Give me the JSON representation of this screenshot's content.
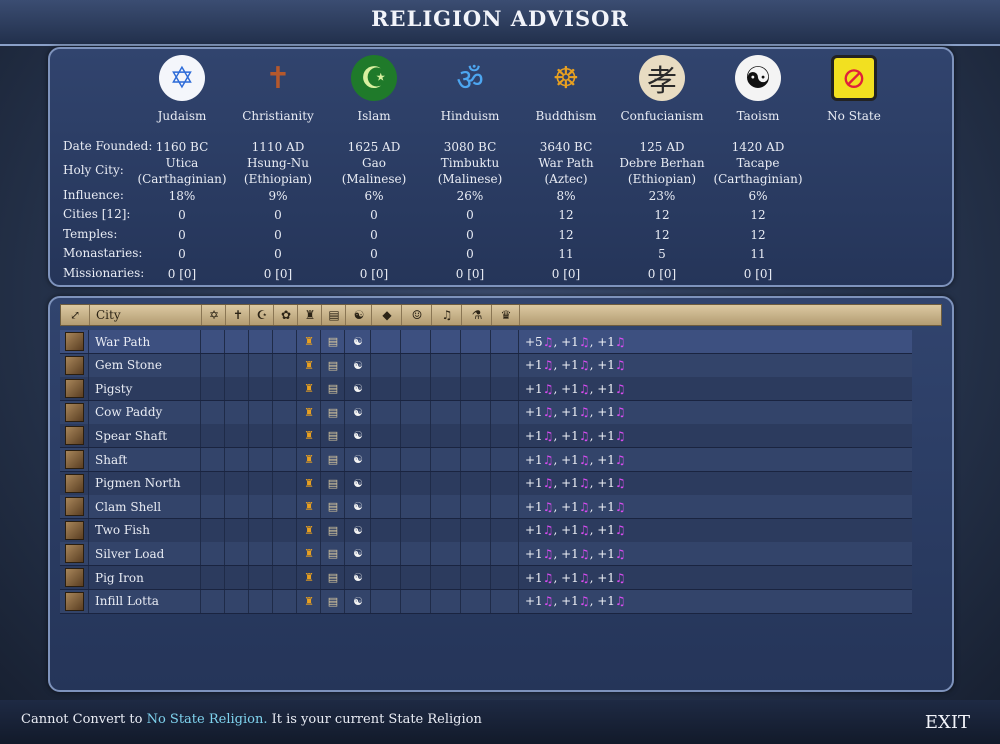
{
  "title": "RELIGION ADVISOR",
  "religions": [
    {
      "name": "Judaism",
      "icon": "star-of-david-icon",
      "glyph": "✡",
      "color": "#2d6bd8",
      "bg": "#f4f6fb",
      "date": "1160 BC",
      "holy1": "Utica",
      "holy2": "(Carthaginian)",
      "influence": "18%",
      "cities": "0",
      "temples": "0",
      "monasteries": "0",
      "missionaries": "0 [0]"
    },
    {
      "name": "Christianity",
      "icon": "cross-icon",
      "glyph": "✝",
      "color": "#b5582c",
      "bg": "transparent",
      "date": "1110 AD",
      "holy1": "Hsung-Nu",
      "holy2": "(Ethiopian)",
      "influence": "9%",
      "cities": "0",
      "temples": "0",
      "monasteries": "0",
      "missionaries": "0 [0]"
    },
    {
      "name": "Islam",
      "icon": "crescent-star-icon",
      "glyph": "☪",
      "color": "#d9f0a0",
      "bg": "#1f7a2a",
      "date": "1625 AD",
      "holy1": "Gao",
      "holy2": "(Malinese)",
      "influence": "6%",
      "cities": "0",
      "temples": "0",
      "monasteries": "0",
      "missionaries": "0 [0]"
    },
    {
      "name": "Hinduism",
      "icon": "om-icon",
      "glyph": "ॐ",
      "color": "#4da6f0",
      "bg": "transparent",
      "date": "3080 BC",
      "holy1": "Timbuktu",
      "holy2": "(Malinese)",
      "influence": "26%",
      "cities": "0",
      "temples": "0",
      "monasteries": "0",
      "missionaries": "0 [0]"
    },
    {
      "name": "Buddhism",
      "icon": "buddha-icon",
      "glyph": "☸",
      "color": "#e8a020",
      "bg": "transparent",
      "date": "3640 BC",
      "holy1": "War Path",
      "holy2": "(Aztec)",
      "influence": "8%",
      "cities": "12",
      "temples": "12",
      "monasteries": "11",
      "missionaries": "0 [0]"
    },
    {
      "name": "Confucianism",
      "icon": "confucian-glyph-icon",
      "glyph": "孝",
      "color": "#2a2a2a",
      "bg": "#e8dcc2",
      "date": "125 AD",
      "holy1": "Debre Berhan",
      "holy2": "(Ethiopian)",
      "influence": "23%",
      "cities": "12",
      "temples": "12",
      "monasteries": "5",
      "missionaries": "0 [0]"
    },
    {
      "name": "Taoism",
      "icon": "yin-yang-icon",
      "glyph": "☯",
      "color": "#111111",
      "bg": "#f4f4f4",
      "date": "1420 AD",
      "holy1": "Tacape",
      "holy2": "(Carthaginian)",
      "influence": "6%",
      "cities": "12",
      "temples": "12",
      "monasteries": "11",
      "missionaries": "0 [0]"
    },
    {
      "name": "No State",
      "icon": "no-state-icon",
      "glyph": "⊘",
      "color": "#e0203a",
      "bg": "#f2e020"
    }
  ],
  "row_labels": {
    "date": "Date Founded:",
    "holy": "Holy City:",
    "influence": "Influence:",
    "cities": "Cities [12]:",
    "temples": "Temples:",
    "monasteries": "Monastaries:",
    "missionaries": "Missionaries:"
  },
  "table": {
    "city_header": "City",
    "columns": [
      "judaism-icon",
      "christianity-icon",
      "islam-icon",
      "hinduism-icon",
      "buddhism-icon",
      "confucianism-icon",
      "taoism-icon",
      "culture-icon",
      "happy-face-icon",
      "music-note-icon",
      "beaker-icon",
      "gold-icon"
    ],
    "column_glyphs": [
      "✡",
      "✝",
      "☪",
      "✿",
      "♜",
      "▤",
      "☯",
      "◆",
      "☺",
      "♫",
      "⚗",
      "♛"
    ],
    "rows": [
      {
        "city": "War Path",
        "effect_first": "+5",
        "effect_rest": "+1"
      },
      {
        "city": "Gem Stone",
        "effect_first": "+1",
        "effect_rest": "+1"
      },
      {
        "city": "Pigsty",
        "effect_first": "+1",
        "effect_rest": "+1"
      },
      {
        "city": "Cow Paddy",
        "effect_first": "+1",
        "effect_rest": "+1"
      },
      {
        "city": "Spear Shaft",
        "effect_first": "+1",
        "effect_rest": "+1"
      },
      {
        "city": "Shaft",
        "effect_first": "+1",
        "effect_rest": "+1"
      },
      {
        "city": "Pigmen North",
        "effect_first": "+1",
        "effect_rest": "+1"
      },
      {
        "city": "Clam Shell",
        "effect_first": "+1",
        "effect_rest": "+1"
      },
      {
        "city": "Two Fish",
        "effect_first": "+1",
        "effect_rest": "+1"
      },
      {
        "city": "Silver Load",
        "effect_first": "+1",
        "effect_rest": "+1"
      },
      {
        "city": "Pig Iron",
        "effect_first": "+1",
        "effect_rest": "+1"
      },
      {
        "city": "Infill Lotta",
        "effect_first": "+1",
        "effect_rest": "+1"
      }
    ]
  },
  "status": {
    "prefix": "Cannot Convert to ",
    "highlight": "No State Religion.",
    "suffix": " It is your current State Religion"
  },
  "exit_label": "EXIT"
}
